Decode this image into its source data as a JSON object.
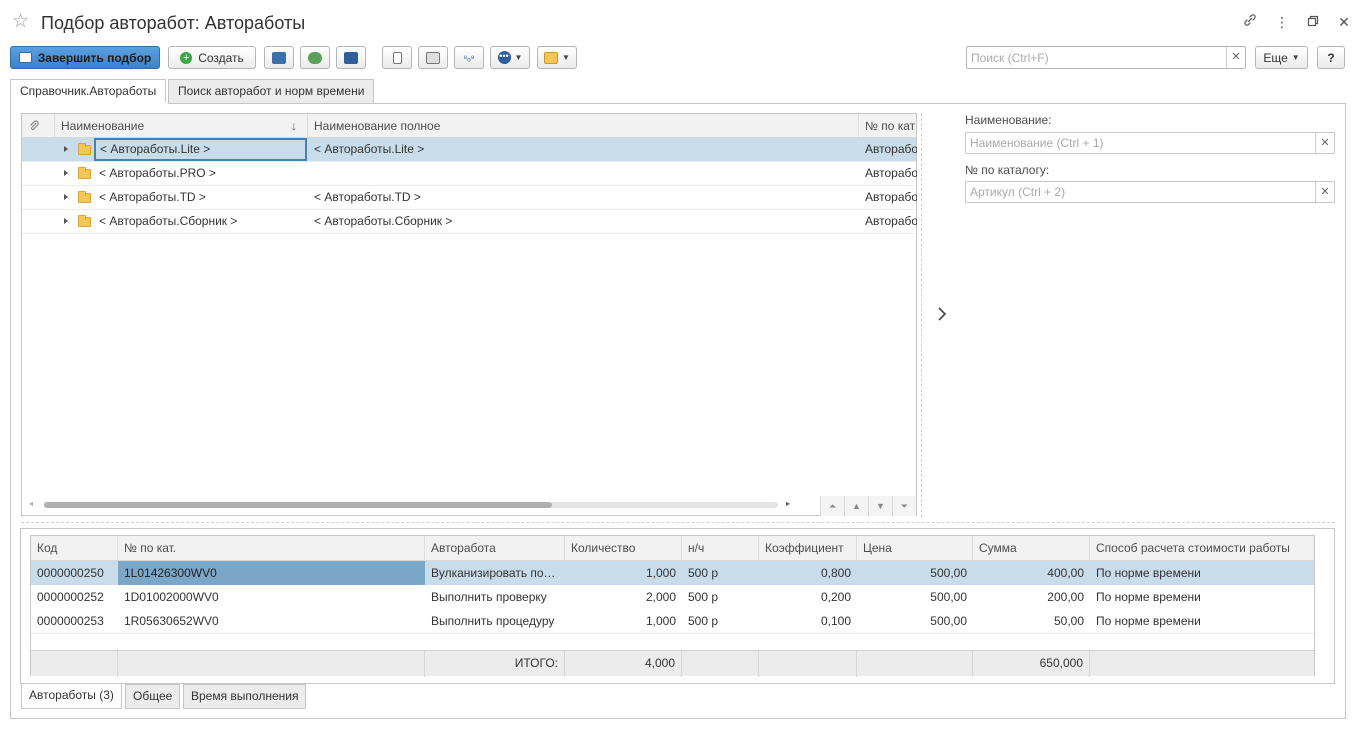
{
  "window": {
    "title": "Подбор авторабот: Автоработы"
  },
  "toolbar": {
    "finish_label": "Завершить подбор",
    "create_label": "Создать",
    "more_label": "Еще",
    "help_label": "?",
    "search_placeholder": "Поиск (Ctrl+F)"
  },
  "tabs": [
    {
      "label": "Справочник.Автоработы",
      "active": true
    },
    {
      "label": "Поиск авторабот и норм времени",
      "active": false
    }
  ],
  "tree": {
    "columns": [
      "Наименование",
      "Наименование полное",
      "№ по кат"
    ],
    "sort_indicator": "↓",
    "rows": [
      {
        "name": "< Автоработы.Lite >",
        "full": "< Автоработы.Lite >",
        "cat": "Авторабот",
        "selected": true
      },
      {
        "name": "< Автоработы.PRO >",
        "full": "",
        "cat": "Авторабот",
        "selected": false
      },
      {
        "name": "< Автоработы.TD >",
        "full": "< Автоработы.TD >",
        "cat": "Авторабот",
        "selected": false
      },
      {
        "name": "< Автоработы.Сборник >",
        "full": "< Автоработы.Сборник >",
        "cat": "Авторабот",
        "selected": false
      }
    ]
  },
  "filters": {
    "name_label": "Наименование:",
    "name_placeholder": "Наименование (Ctrl + 1)",
    "catalog_label": "№ по каталогу:",
    "catalog_placeholder": "Артикул (Ctrl + 2)"
  },
  "selected_table": {
    "columns": [
      "Код",
      "№ по кат.",
      "Авторабота",
      "Количество",
      "н/ч",
      "Коэффициент",
      "Цена",
      "Сумма",
      "Способ расчета стоимости работы"
    ],
    "rows": [
      {
        "code": "0000000250",
        "cat": "1L01426300WV0",
        "work": "Вулканизировать полуось",
        "qty": "1,000",
        "nh": "500 р",
        "coef": "0,800",
        "price": "500,00",
        "sum": "400,00",
        "method": "По норме времени",
        "selected": true
      },
      {
        "code": "0000000252",
        "cat": "1D01002000WV0",
        "work": "Выполнить проверку",
        "qty": "2,000",
        "nh": "500 р",
        "coef": "0,200",
        "price": "500,00",
        "sum": "200,00",
        "method": "По норме времени",
        "selected": false
      },
      {
        "code": "0000000253",
        "cat": "1R05630652WV0",
        "work": "Выполнить процедуру",
        "qty": "1,000",
        "nh": "500 р",
        "coef": "0,100",
        "price": "500,00",
        "sum": "50,00",
        "method": "По норме времени",
        "selected": false
      }
    ],
    "totals": {
      "label": "ИТОГО:",
      "qty": "4,000",
      "sum": "650,000"
    }
  },
  "bottom_tabs": [
    {
      "label": "Автоработы (3)",
      "active": true
    },
    {
      "label": "Общее",
      "active": false
    },
    {
      "label": "Время выполнения",
      "active": false
    }
  ]
}
